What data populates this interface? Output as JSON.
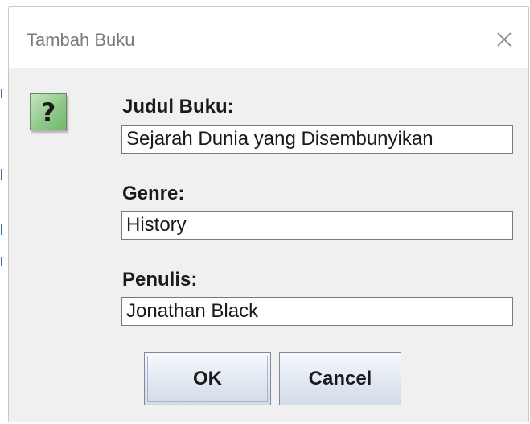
{
  "window": {
    "title": "Tambah Buku",
    "close_glyph": "✕"
  },
  "icon": {
    "name": "question-icon",
    "glyph": "?",
    "color": "#8fc98a"
  },
  "fields": [
    {
      "label": "Judul Buku:",
      "value": "Sejarah Dunia yang Disembunyikan"
    },
    {
      "label": "Genre:",
      "value": "History"
    },
    {
      "label": "Penulis:",
      "value": "Jonathan Black"
    }
  ],
  "buttons": {
    "ok_label": "OK",
    "cancel_label": "Cancel"
  }
}
